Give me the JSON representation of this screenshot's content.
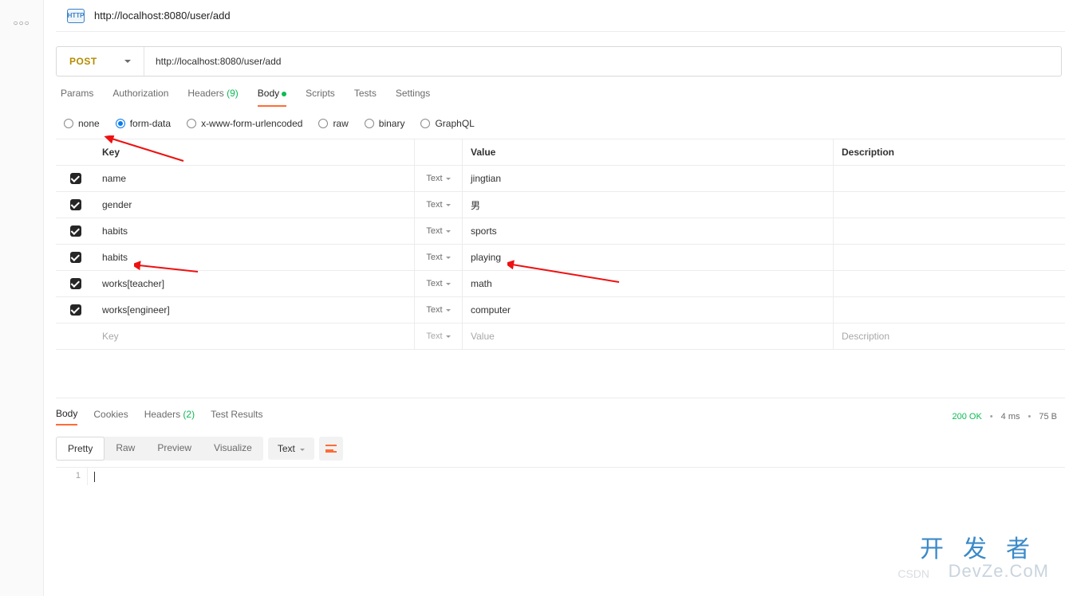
{
  "tab": {
    "title": "http://localhost:8080/user/add",
    "icon_label": "HTTP"
  },
  "request": {
    "method": "POST",
    "url": "http://localhost:8080/user/add",
    "tabs": {
      "params": "Params",
      "auth": "Authorization",
      "headers": "Headers",
      "headers_count": "(9)",
      "body": "Body",
      "scripts": "Scripts",
      "tests": "Tests",
      "settings": "Settings"
    },
    "body_types": {
      "none": "none",
      "form_data": "form-data",
      "urlencoded": "x-www-form-urlencoded",
      "raw": "raw",
      "binary": "binary",
      "graphql": "GraphQL"
    },
    "table": {
      "head_key": "Key",
      "head_value": "Value",
      "head_desc": "Description",
      "type_label": "Text",
      "rows": [
        {
          "key": "name",
          "value": "jingtian"
        },
        {
          "key": "gender",
          "value": "男"
        },
        {
          "key": "habits",
          "value": "sports"
        },
        {
          "key": "habits",
          "value": "playing"
        },
        {
          "key": "works[teacher]",
          "value": "math"
        },
        {
          "key": "works[engineer]",
          "value": "computer"
        }
      ],
      "placeholder_key": "Key",
      "placeholder_value": "Value",
      "placeholder_desc": "Description"
    }
  },
  "response": {
    "tabs": {
      "body": "Body",
      "cookies": "Cookies",
      "headers": "Headers",
      "headers_count": "(2)",
      "results": "Test Results"
    },
    "status": "200 OK",
    "time": "4 ms",
    "size": "75 B",
    "views": {
      "pretty": "Pretty",
      "raw": "Raw",
      "preview": "Preview",
      "visualize": "Visualize"
    },
    "lang": "Text",
    "line_no": "1"
  },
  "watermark": {
    "cn": "开发者",
    "en": "DevZe.CoM",
    "csdn": "CSDN"
  }
}
